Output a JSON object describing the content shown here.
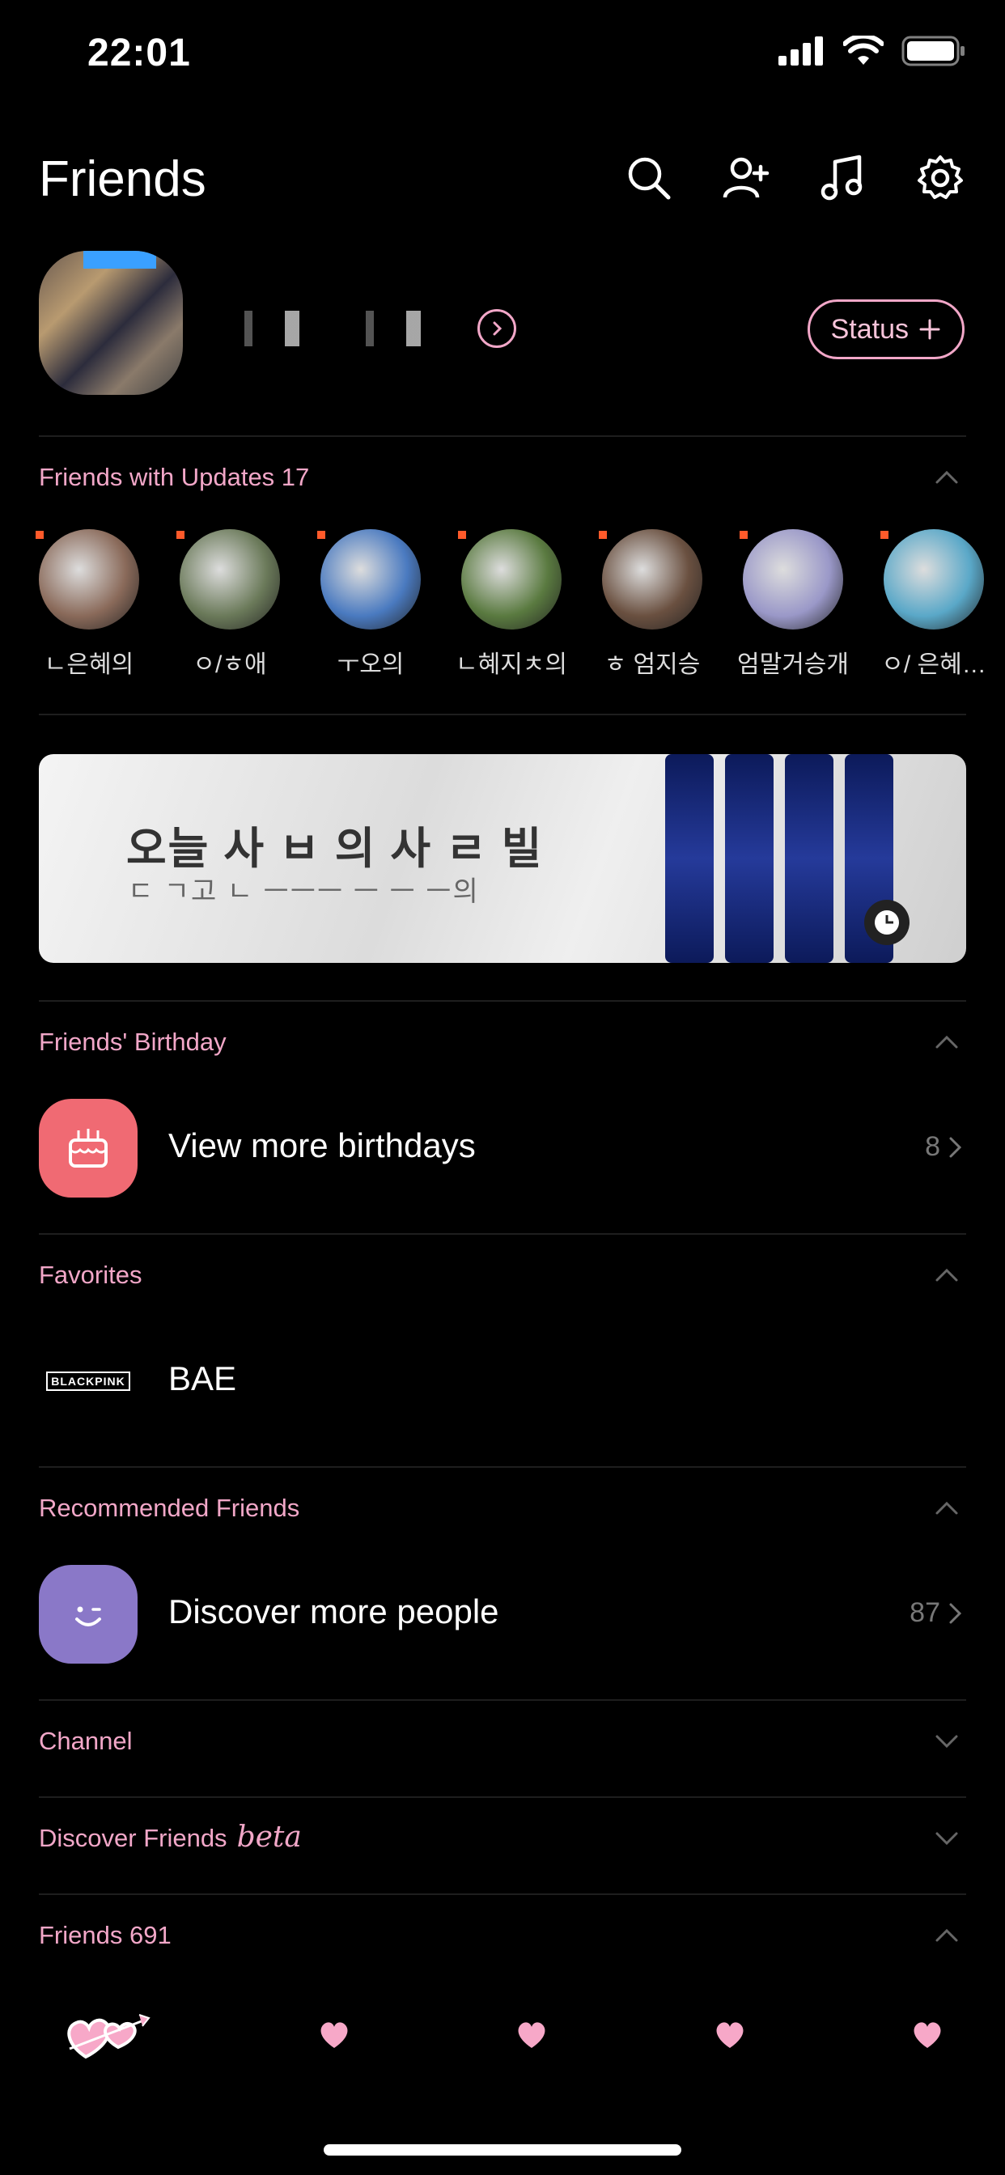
{
  "status_bar": {
    "time": "22:01"
  },
  "header": {
    "title": "Friends"
  },
  "profile": {
    "status_label": "Status"
  },
  "sections": {
    "updates": {
      "title": "Friends with Updates 17",
      "friends": [
        {
          "label": "ㄴ은혜의",
          "color": "#8a6a5a"
        },
        {
          "label": "ㅇ/ㅎ애",
          "color": "#6b7a5a"
        },
        {
          "label": "ㅜ오의",
          "color": "#4a7ac0"
        },
        {
          "label": "ㄴ혜지ㅊ의",
          "color": "#5a7a40"
        },
        {
          "label": "ㅎ 엄지승",
          "color": "#6a5040"
        },
        {
          "label": "엄말거승개",
          "color": "#9a98c8"
        },
        {
          "label": "ㅇ/ 은혜…",
          "color": "#5aa8c8"
        }
      ]
    },
    "banner": {
      "line1": "오늘 사 ㅂ 의 사 ㄹ 빌",
      "line2": "ㄷ ㄱ고 ㄴ ㅡㅡㅡ ㅡ ㅡ ㅡ의"
    },
    "birthday": {
      "title": "Friends' Birthday",
      "row_label": "View more birthdays",
      "count": "8"
    },
    "favorites": {
      "title": "Favorites",
      "row_label": "BAE",
      "logo_text": "BLACKPINK"
    },
    "recommended": {
      "title": "Recommended Friends",
      "row_label": "Discover more people",
      "count": "87"
    },
    "channel": {
      "title": "Channel"
    },
    "discover": {
      "title": "Discover Friends",
      "beta": "beta"
    },
    "friends": {
      "title": "Friends 691"
    }
  },
  "colors": {
    "accent_pink": "#f2a7c8",
    "birthday_icon": "#f06a73",
    "recommend_icon": "#8a78c8"
  }
}
